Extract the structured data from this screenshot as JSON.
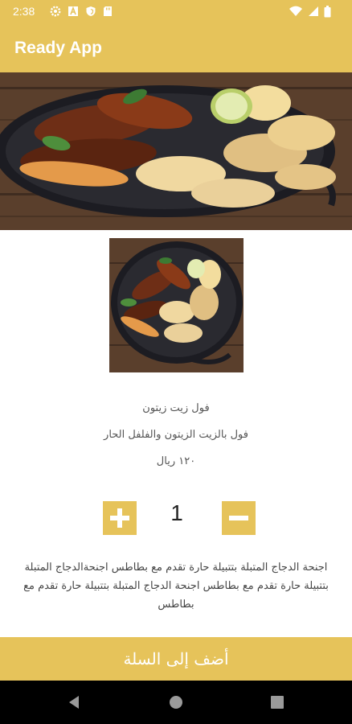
{
  "status_bar": {
    "time": "2:38",
    "left_icons": [
      "gear-icon",
      "a-icon",
      "shield-icon",
      "sd-card-icon"
    ],
    "right_icons": [
      "wifi-icon",
      "signal-icon",
      "battery-icon"
    ]
  },
  "app_bar": {
    "title": "Ready App"
  },
  "hero": {
    "image": "grilled-chicken-wings-with-chips-photo"
  },
  "product": {
    "thumbnail": "grilled-chicken-wings-with-chips-photo",
    "name": "فول زيت زيتون",
    "subtitle": "فول بالزيت الزيتون والفلفل الحار",
    "price": "١٢٠ ريال",
    "description": "اجنحة الدجاج المتبلة  بتتبيلة حارة تقدم مع بطاطس اجنحةالدجاج المتبلة  بتتبيلة حارة تقدم مع بطاطس اجنحة الدجاج المتبلة  بتتبيلة حارة تقدم مع بطاطس"
  },
  "quantity": {
    "value": "1",
    "increment_icon": "plus-icon",
    "decrement_icon": "minus-icon"
  },
  "cart_button": {
    "label": "أضف إلى السلة"
  },
  "nav_bar": {
    "icons": [
      "back-icon",
      "home-icon",
      "recents-icon"
    ]
  },
  "colors": {
    "accent": "#e6c35a",
    "nav": "#000000",
    "text": "#555555"
  }
}
